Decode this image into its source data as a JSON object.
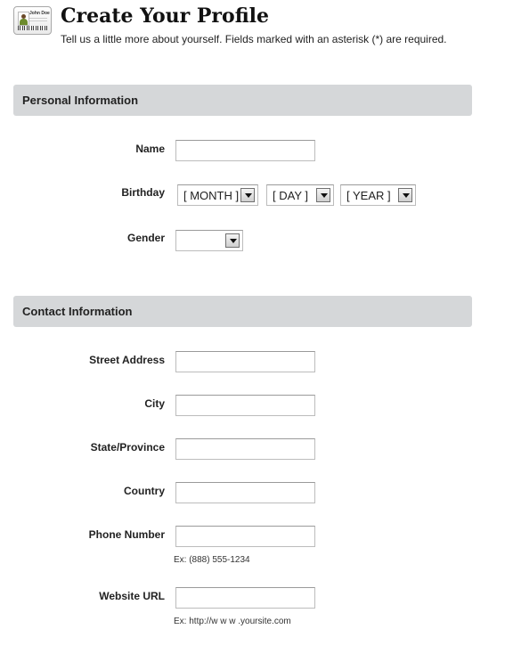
{
  "header": {
    "title": "Create Your Profile",
    "subtitle": "Tell us a little more about yourself. Fields marked with an asterisk (*) are required.",
    "card_name": "John Doe",
    "icon": "id-card-icon"
  },
  "sections": {
    "personal": {
      "title": "Personal Information"
    },
    "contact": {
      "title": "Contact Information"
    }
  },
  "fields": {
    "name": {
      "label": "Name",
      "value": ""
    },
    "birthday": {
      "label": "Birthday",
      "month": "[ MONTH ]",
      "day": "[ DAY ]",
      "year": "[ YEAR ]"
    },
    "gender": {
      "label": "Gender",
      "value": ""
    },
    "street_address": {
      "label": "Street Address",
      "value": ""
    },
    "city": {
      "label": "City",
      "value": ""
    },
    "state": {
      "label": "State/Province",
      "value": ""
    },
    "country": {
      "label": "Country",
      "value": ""
    },
    "phone": {
      "label": "Phone Number",
      "value": "",
      "hint": "Ex: (888) 555-1234"
    },
    "website": {
      "label": "Website URL",
      "value": "",
      "hint": "Ex: http://w w w .yoursite.com"
    }
  }
}
